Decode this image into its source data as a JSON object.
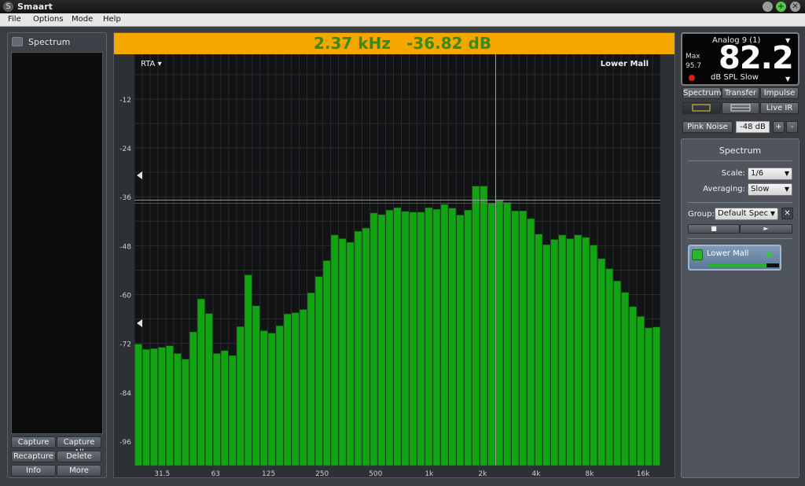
{
  "window": {
    "title": "Smaart",
    "app_icon": "smaart-logo-icon",
    "controls": [
      "minimize-icon",
      "maximize-icon",
      "close-icon"
    ],
    "maximize_glyph": "+",
    "close_glyph": "✕"
  },
  "menu": [
    "File",
    "Options",
    "Mode",
    "Help"
  ],
  "left_panel": {
    "title": "Spectrum",
    "buttons": {
      "capture": "Capture",
      "capture_all": "Capture All",
      "recapture": "Recapture",
      "delete": "Delete",
      "info": "Info",
      "more": "More"
    }
  },
  "readout": {
    "frequency": "2.37 kHz",
    "level": "-36.82 dB",
    "background_color": "#f5a700",
    "text_color": "#3a8a1a"
  },
  "plot": {
    "mode_label": "RTA ▾",
    "measurement_label": "Lower Mall",
    "bar_color": "#12a512"
  },
  "chart_data": {
    "type": "bar",
    "title": "",
    "xlabel": "",
    "ylabel": "",
    "x_scale": "log",
    "x_tick_labels": [
      "31.5",
      "63",
      "125",
      "250",
      "500",
      "1k",
      "2k",
      "4k",
      "8k",
      "16k"
    ],
    "y_tick_labels": [
      "-12",
      "-24",
      "-36",
      "-48",
      "-60",
      "-72",
      "-84",
      "-96"
    ],
    "ylim": [
      -102,
      -1
    ],
    "grid": true,
    "cursor": {
      "frequency_hz": 2370,
      "level_db": -36.82
    },
    "series": [
      {
        "values": [
          -72.2,
          -73.5,
          -73.3,
          -73.0,
          -72.6,
          -74.5,
          -75.9,
          -69.2,
          -61.1,
          -64.7,
          -74.5,
          -73.8,
          -75.0,
          -67.9,
          -55.2,
          -62.8,
          -68.9,
          -69.5,
          -67.7,
          -64.8,
          -64.5,
          -63.7,
          -59.6,
          -55.6,
          -51.7,
          -45.4,
          -46.3,
          -47.2,
          -44.5,
          -43.7,
          -40.0,
          -40.4,
          -39.3,
          -38.7,
          -39.6,
          -39.8,
          -39.8,
          -38.7,
          -39.1,
          -37.9,
          -38.8,
          -40.5,
          -39.3,
          -33.4,
          -33.4,
          -37.6,
          -36.7,
          -37.4,
          -39.5,
          -39.5,
          -41.4,
          -45.2,
          -47.8,
          -46.5,
          -45.4,
          -46.3,
          -45.4,
          -46.0,
          -47.9,
          -51.2,
          -53.7,
          -56.7,
          -59.5,
          -63.0,
          -65.4,
          -68.2,
          -68.0
        ]
      }
    ]
  },
  "spl_meter": {
    "channel": "Analog 9 (1)",
    "max_label": "Max",
    "max_value": "95.7",
    "value": "82.2",
    "units": "dB SPL Slow"
  },
  "mode_tabs": [
    "Spectrum",
    "Transfer",
    "Impulse"
  ],
  "view_buttons": {
    "live_ir": "Live IR",
    "icons": [
      "single-plot-icon",
      "dual-plot-icon"
    ]
  },
  "signal": {
    "pink_noise": "Pink Noise",
    "level": "-48 dB",
    "plus": "+",
    "minus": "-"
  },
  "controls": {
    "title": "Spectrum",
    "scale_label": "Scale:",
    "scale_value": "1/6",
    "averaging_label": "Averaging:",
    "averaging_value": "Slow",
    "group_label": "Group:",
    "group_value": "Default Spec",
    "stop_glyph": "■",
    "play_glyph": "►"
  },
  "measurement": {
    "name": "Lower Mall",
    "play_glyph": "▶",
    "meter_level": 0.82
  }
}
